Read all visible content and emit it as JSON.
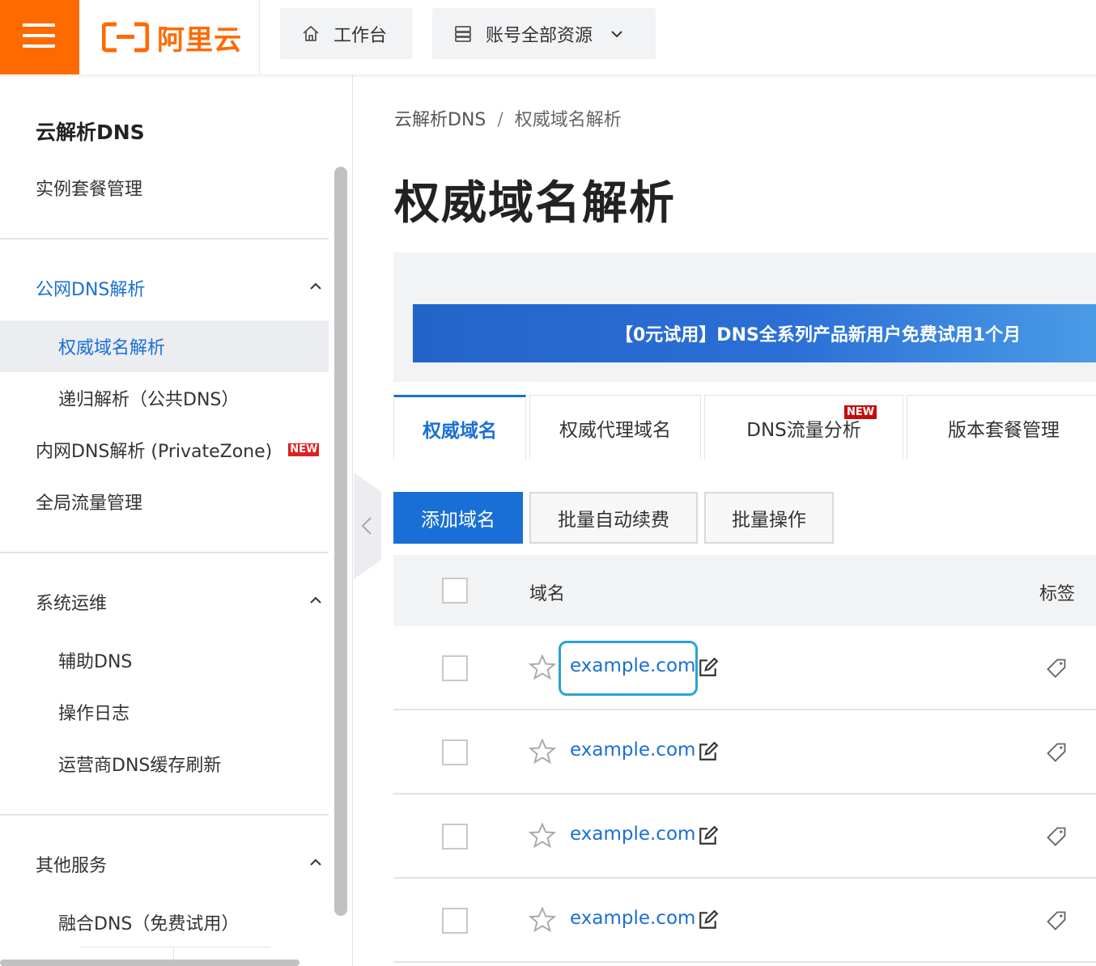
{
  "header": {
    "logo_text": "阿里云",
    "workbench_label": "工作台",
    "resources_label": "账号全部资源",
    "brand_color": "#ff6a00"
  },
  "sidebar": {
    "title": "云解析DNS",
    "instance_label": "实例套餐管理",
    "groups": [
      {
        "label": "公网DNS解析",
        "items": [
          "权威域名解析",
          "递归解析（公共DNS）"
        ]
      },
      {
        "label": "系统运维",
        "items": [
          "辅助DNS",
          "操作日志",
          "运营商DNS缓存刷新"
        ]
      },
      {
        "label": "其他服务",
        "items": [
          "融合DNS（免费试用）"
        ]
      }
    ],
    "private_zone_label": "内网DNS解析 (PrivateZone)",
    "private_zone_badge": "NEW",
    "global_traffic_label": "全局流量管理",
    "active_item": "权威域名解析"
  },
  "breadcrumb": {
    "root": "云解析DNS",
    "separator": "/",
    "current": "权威域名解析"
  },
  "page_title": "权威域名解析",
  "banner_text": "【0元试用】DNS全系列产品新用户免费试用1个月",
  "tabs": [
    {
      "label": "权威域名",
      "active": true
    },
    {
      "label": "权威代理域名",
      "active": false
    },
    {
      "label": "DNS流量分析",
      "active": false,
      "badge": "NEW"
    },
    {
      "label": "版本套餐管理",
      "active": false
    }
  ],
  "actions": {
    "add_domain": "添加域名",
    "batch_renew": "批量自动续费",
    "batch_ops": "批量操作"
  },
  "table": {
    "columns": [
      "域名",
      "标签"
    ],
    "rows": [
      {
        "domain": "example.com"
      },
      {
        "domain": "example.com"
      },
      {
        "domain": "example.com"
      },
      {
        "domain": "example.com"
      }
    ]
  },
  "colors": {
    "accent_blue": "#1a6fd6",
    "focus_ring": "#29a3d6",
    "new_badge": "#e02020"
  }
}
